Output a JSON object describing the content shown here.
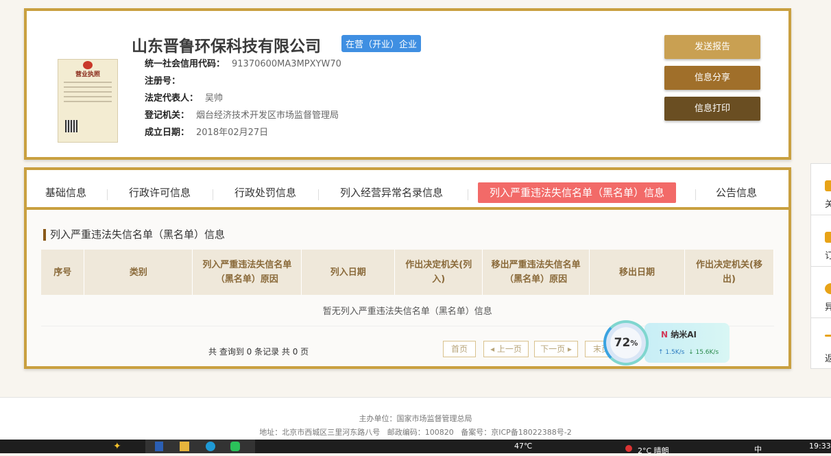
{
  "company": {
    "name": "山东晋鲁环保科技有限公司",
    "status_badge": "在营（开业）企业",
    "license_heading": "营业执照",
    "fields": [
      {
        "label": "统一社会信用代码：",
        "value": "91370600MA3MPXYW70"
      },
      {
        "label": "注册号：",
        "value": ""
      },
      {
        "label": "法定代表人：",
        "value": "吴帅"
      },
      {
        "label": "登记机关：",
        "value": "烟台经济技术开发区市场监督管理局"
      },
      {
        "label": "成立日期：",
        "value": "2018年02月27日"
      }
    ]
  },
  "actions": {
    "send_report": "发送报告",
    "share": "信息分享",
    "print": "信息打印"
  },
  "tabs": [
    "基础信息",
    "行政许可信息",
    "行政处罚信息",
    "列入经营异常名录信息",
    "列入严重违法失信名单（黑名单）信息",
    "公告信息"
  ],
  "section": {
    "title": "列入严重违法失信名单（黑名单）信息",
    "columns": [
      "序号",
      "类别",
      "列入严重违法失信名单（黑名单）原因",
      "列入日期",
      "作出决定机关(列入)",
      "移出严重违法失信名单（黑名单）原因",
      "移出日期",
      "作出决定机关(移出)"
    ],
    "empty_text": "暂无列入严重违法失信名单（黑名单）信息"
  },
  "pagination": {
    "summary": "共 查询到 0 条记录 共 0 页",
    "first": "首页",
    "prev": "上一页",
    "next": "下一页",
    "last": "末页"
  },
  "sidebar": [
    "关",
    "订",
    "异",
    "返"
  ],
  "widget": {
    "percent": "72",
    "percent_sign": "%",
    "name": "纳米AI",
    "up": "↑ 1.5K/s",
    "down": "↓ 15.6K/s"
  },
  "footer": {
    "host": "主办单位：国家市场监督管理总局",
    "address": "地址：北京市西城区三里河东路八号   邮政编码：100820   备案号：京ICP备18022388号-2"
  },
  "taskbar": {
    "temp": "47℃",
    "weather": "2°C 晴朗",
    "ime": "中",
    "time": "19:33"
  }
}
